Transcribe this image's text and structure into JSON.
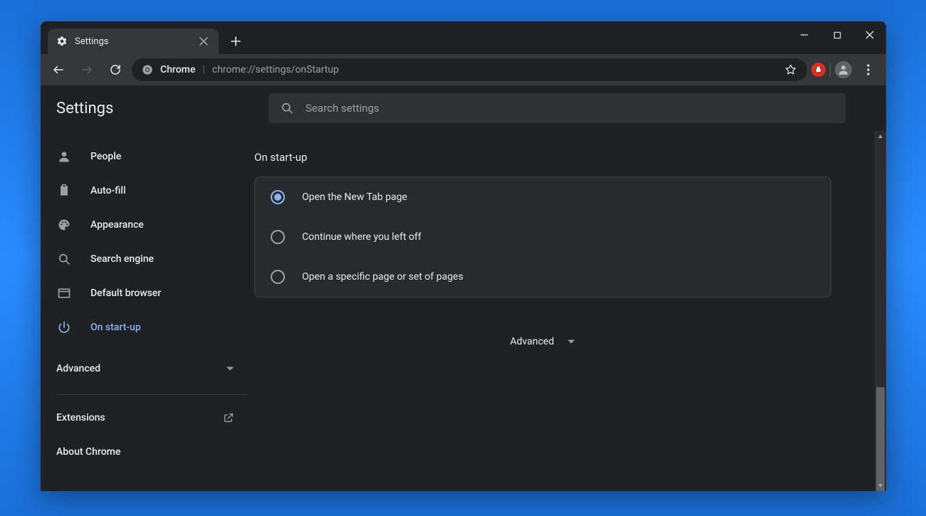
{
  "tab": {
    "title": "Settings"
  },
  "omnibox": {
    "chip": "Chrome",
    "path": "chrome://settings/onStartup"
  },
  "header": {
    "title": "Settings"
  },
  "search": {
    "placeholder": "Search settings"
  },
  "sidebar": {
    "items": [
      {
        "label": "People"
      },
      {
        "label": "Auto-fill"
      },
      {
        "label": "Appearance"
      },
      {
        "label": "Search engine"
      },
      {
        "label": "Default browser"
      },
      {
        "label": "On start-up"
      }
    ],
    "advanced": "Advanced",
    "links": {
      "extensions": "Extensions",
      "about": "About Chrome"
    }
  },
  "main": {
    "section_title": "On start-up",
    "options": [
      {
        "label": "Open the New Tab page",
        "selected": true
      },
      {
        "label": "Continue where you left off",
        "selected": false
      },
      {
        "label": "Open a specific page or set of pages",
        "selected": false
      }
    ],
    "advanced": "Advanced"
  },
  "colors": {
    "accent": "#8ab4f8",
    "bg": "#202124",
    "card": "#292a2d"
  }
}
